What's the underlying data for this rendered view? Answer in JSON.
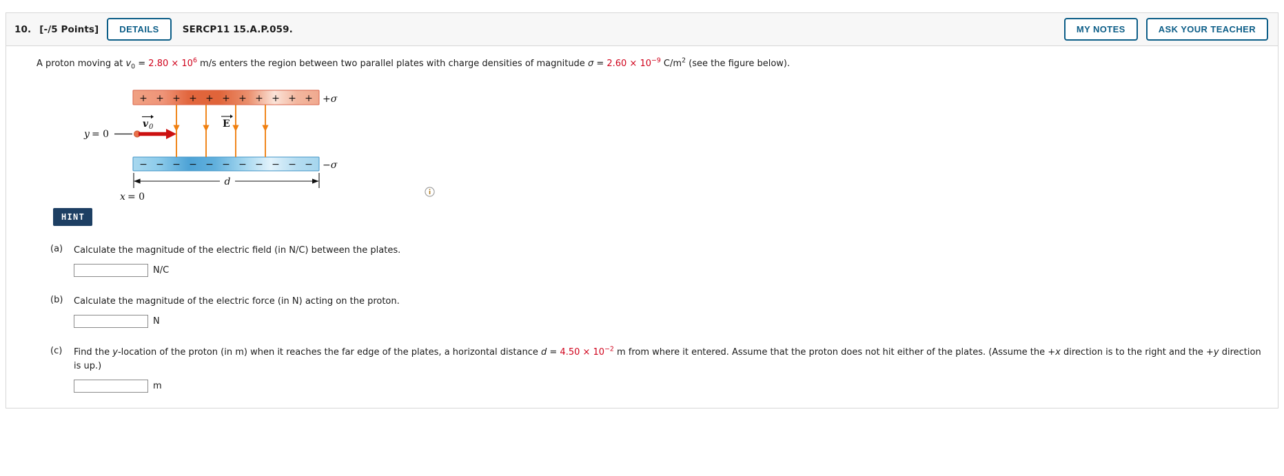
{
  "header": {
    "number": "10.",
    "points": "[-/5 Points]",
    "details_label": "DETAILS",
    "code": "SERCP11 15.A.P.059.",
    "my_notes_label": "MY NOTES",
    "ask_teacher_label": "ASK YOUR TEACHER"
  },
  "statement": {
    "p1": "A proton moving at ",
    "v_symbol": "v",
    "v_sub": "0",
    "eq1": " = ",
    "v_value": "2.80 × 10",
    "v_exp": "6",
    "p2": " m/s enters the region between two parallel plates with charge densities of magnitude ",
    "sigma_symbol": "σ",
    "eq2": " = ",
    "sigma_value": "2.60 × 10",
    "sigma_exp": "−9",
    "p3": " C/m",
    "unit_exp": "2",
    "p4": " (see the figure below)."
  },
  "figure": {
    "top_plate_label": "+σ",
    "bottom_plate_label": "−σ",
    "top_charge_glyph": "+",
    "bottom_charge_glyph": "−",
    "top_charge_count": 11,
    "bottom_charge_count": 11,
    "field_line_count": 4,
    "y_label": "y = 0",
    "x_label": "x = 0",
    "velocity_label": "v",
    "velocity_sub": "0",
    "efield_label": "E",
    "distance_label": "d",
    "info_icon": "info-icon",
    "colors": {
      "positive_plate": "#e8714a",
      "negative_plate": "#56a8d8",
      "field_line": "#f08010",
      "velocity_arrow": "#cc1111",
      "proton": "#e8714a"
    }
  },
  "hint": {
    "label": "HINT"
  },
  "parts": [
    {
      "label": "(a)",
      "text": "Calculate the magnitude of the electric field (in N/C) between the plates.",
      "value": "",
      "placeholder": "",
      "unit": "N/C"
    },
    {
      "label": "(b)",
      "text": "Calculate the magnitude of the electric force (in N) acting on the proton.",
      "value": "",
      "placeholder": "",
      "unit": "N"
    },
    {
      "label": "(c)",
      "text_a": "Find the ",
      "text_y": "y",
      "text_b": "-location of the proton (in m) when it reaches the far edge of the plates, a horizontal distance ",
      "text_d": "d",
      "text_eq": " = ",
      "d_value": "4.50 × 10",
      "d_exp": "−2",
      "text_c": " m from where it entered. Assume that the proton does not hit either of the plates. (Assume the +",
      "text_x2": "x",
      "text_d2": " direction is to the right and the +",
      "text_y2": "y",
      "text_e": " direction is up.)",
      "value": "",
      "placeholder": "",
      "unit": "m"
    }
  ]
}
